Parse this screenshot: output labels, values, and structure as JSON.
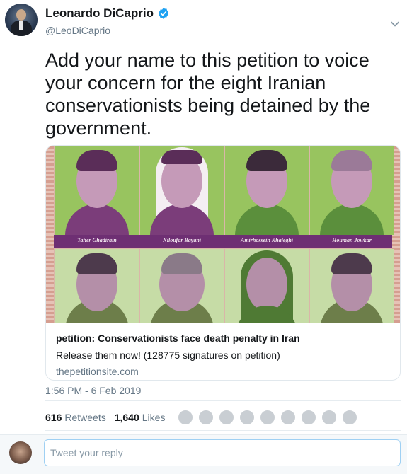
{
  "author": {
    "display_name": "Leonardo DiCaprio",
    "handle": "@LeoDiCaprio",
    "verified": true
  },
  "tweet": {
    "text": "Add your name to this petition to voice your concern for the eight Iranian conservationists being detained by the government.",
    "timestamp": "1:56 PM - 6 Feb 2019"
  },
  "card": {
    "image_captions": [
      "Taher Ghadirain",
      "Niloufar Bayani",
      "Amirhossein Khaleghi",
      "Houman Jowkar"
    ],
    "title": "petition: Conservationists face death penalty in Iran",
    "description": "Release them now! (128775 signatures on petition)",
    "domain": "thepetitionsite.com"
  },
  "stats": {
    "retweets_count": "616",
    "retweets_label": "Retweets",
    "likes_count": "1,640",
    "likes_label": "Likes",
    "liker_avatar_count": 9
  },
  "reply": {
    "placeholder": "Tweet your reply"
  },
  "colors": {
    "verified": "#1da1f2",
    "text": "#14171a",
    "muted": "#657786",
    "portrait_green": "#98c45f",
    "portrait_purple": "#7b3d7a"
  },
  "icons": {
    "verified": "verified-badge-icon",
    "more": "chevron-down-icon"
  }
}
